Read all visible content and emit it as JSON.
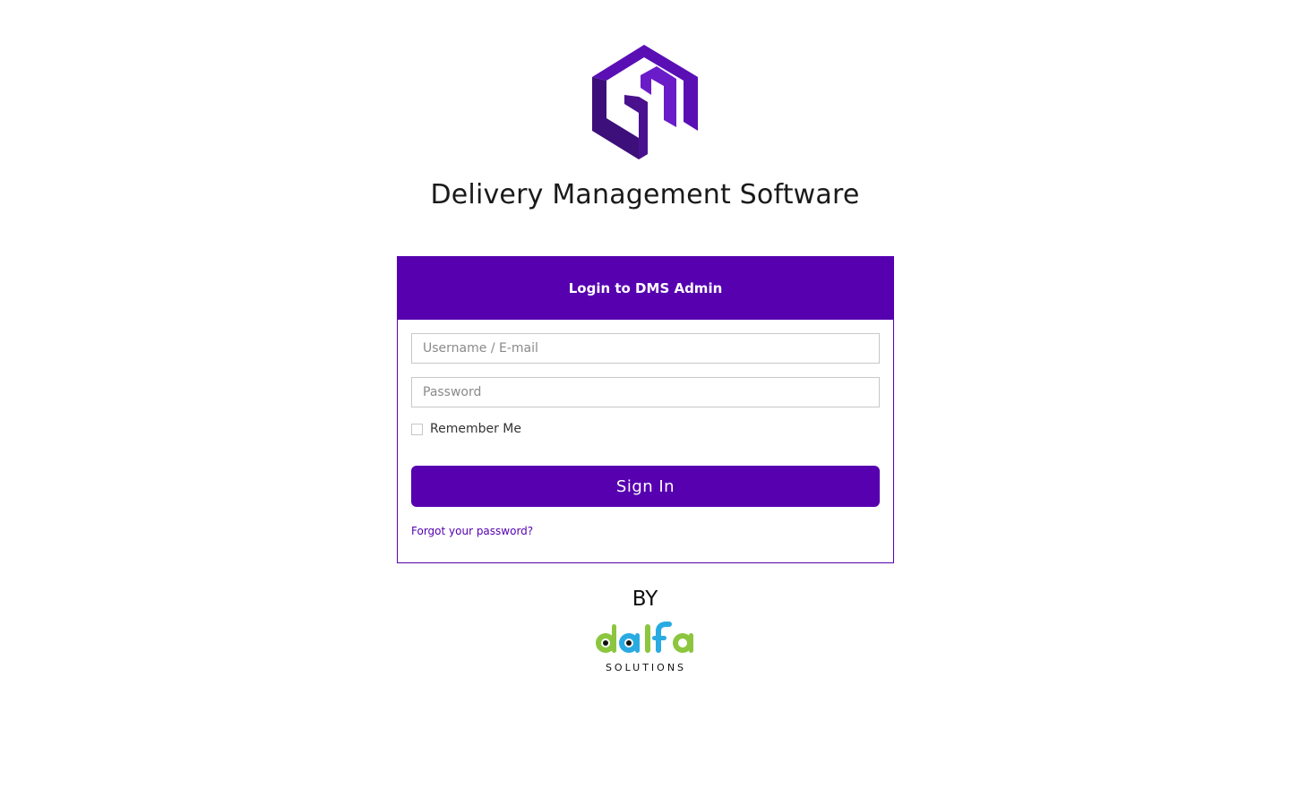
{
  "app": {
    "title": "Delivery Management Software",
    "logo_icon": "cube-logo-icon",
    "brand_color": "#5600b0"
  },
  "login": {
    "header": "Login to DMS Admin",
    "username_placeholder": "Username / E-mail",
    "password_placeholder": "Password",
    "remember_label": "Remember Me",
    "remember_checked": false,
    "signin_label": "Sign In",
    "forgot_label": "Forgot your password?"
  },
  "footer": {
    "by_label": "BY",
    "company_wordmark": "dalfa",
    "company_subtitle": "SOLUTIONS"
  }
}
